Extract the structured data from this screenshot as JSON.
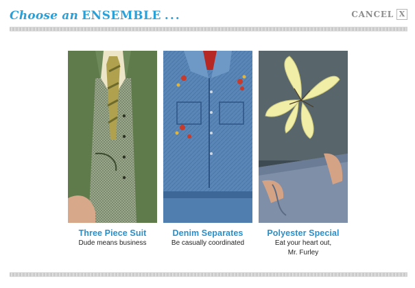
{
  "header": {
    "title_prefix": "Choose an",
    "title_emphasis": "ENSEMBLE",
    "title_suffix": "...",
    "cancel_label": "CANCEL",
    "cancel_x": "X"
  },
  "colors": {
    "title": "#2aa0d8",
    "option_title": "#2a8fc9",
    "cancel": "#8c8c8c"
  },
  "options": [
    {
      "title": "Three Piece Suit",
      "subtitle_line1": "Dude means business",
      "subtitle_line2": ""
    },
    {
      "title": "Denim Separates",
      "subtitle_line1": "Be casually coordinated",
      "subtitle_line2": ""
    },
    {
      "title": "Polyester Special",
      "subtitle_line1": "Eat your heart out,",
      "subtitle_line2": "Mr. Furley"
    }
  ]
}
